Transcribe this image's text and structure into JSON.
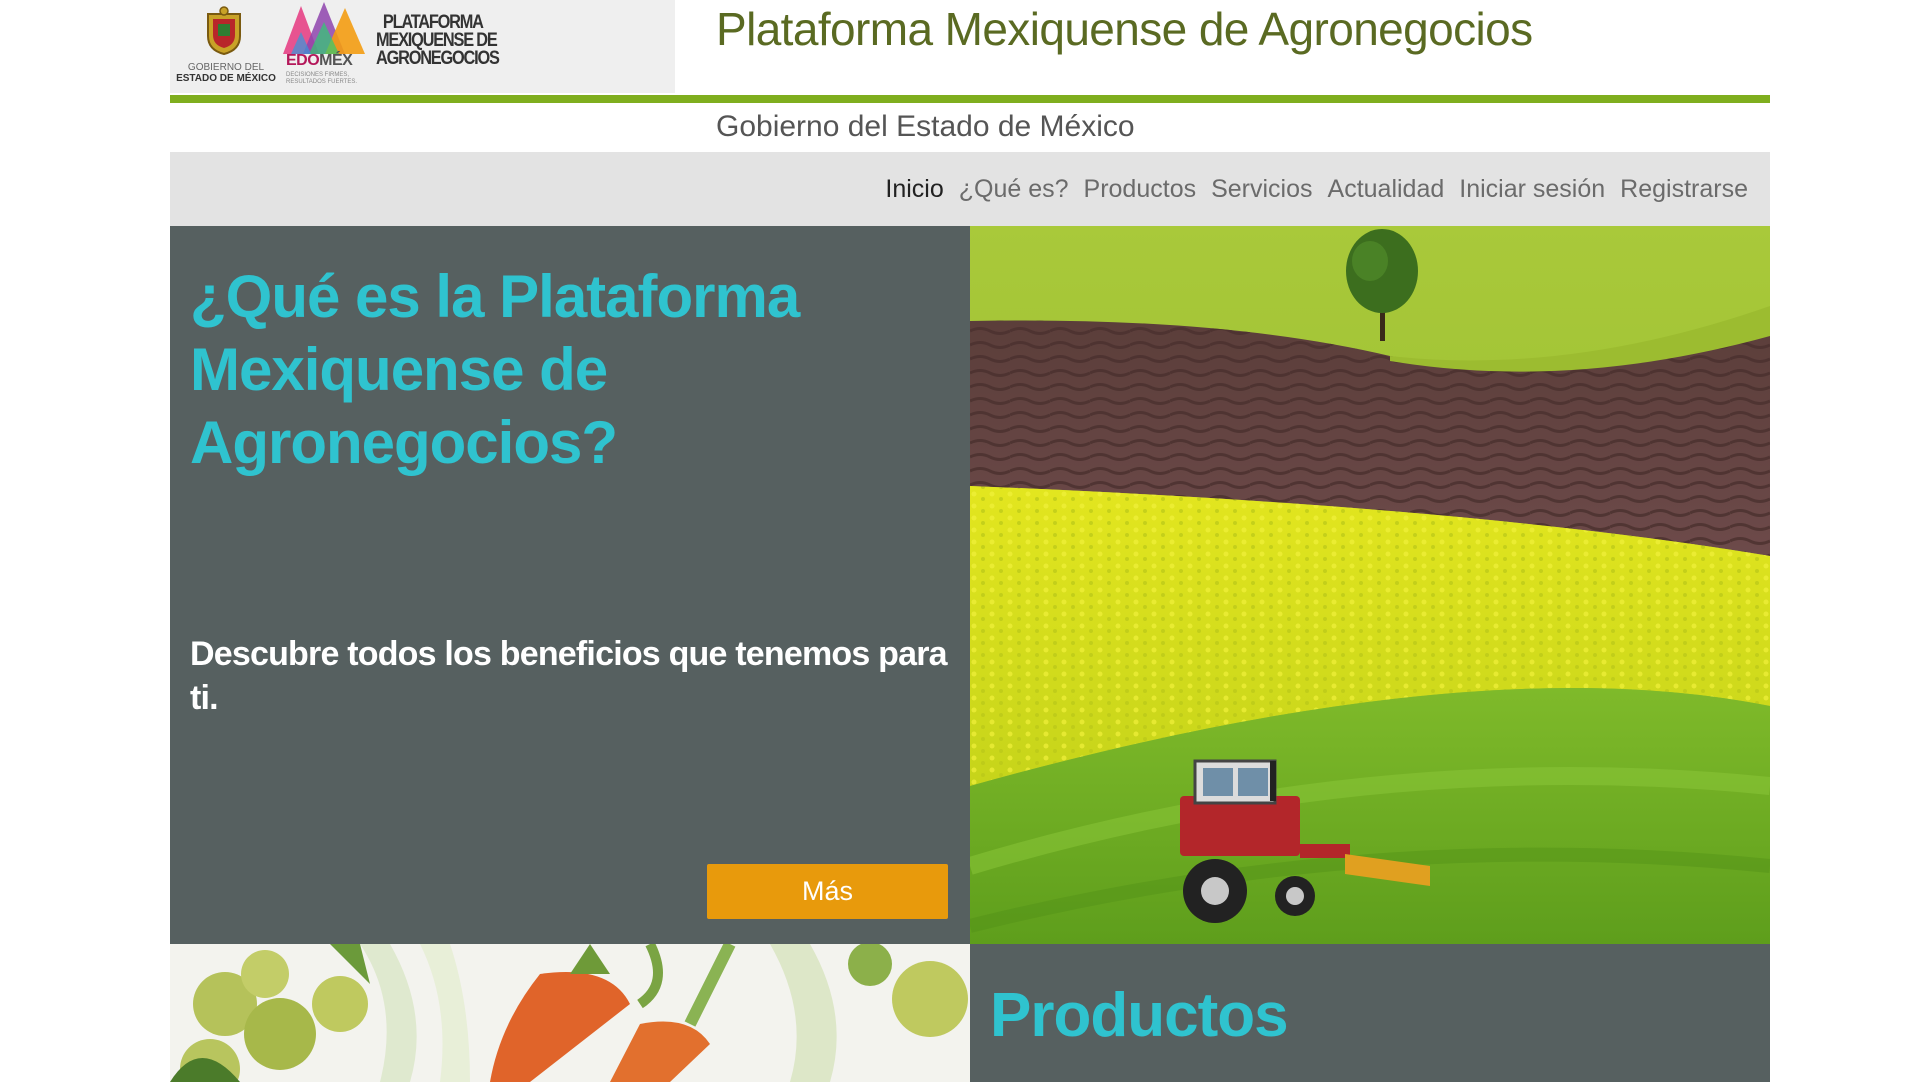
{
  "header": {
    "gob_logo_line1": "GOBIERNO DEL",
    "gob_logo_line2": "ESTADO DE MÉXICO",
    "edomex_prefix": "EDO",
    "edomex_suffix": "MÉX",
    "edomex_slogan_line1": "DECISIONES FIRMES,",
    "edomex_slogan_line2": "RESULTADOS FUERTES.",
    "platform_logo_line1": "PLATAFORMA",
    "platform_logo_line2": "MEXIQUENSE DE",
    "platform_logo_line3": "AGRONEGOCIOS",
    "site_title": "Plataforma Mexiquense de Agronegocios",
    "subtitle": "Gobierno del Estado de México"
  },
  "nav": {
    "items": [
      {
        "label": "Inicio"
      },
      {
        "label": "¿Qué es?"
      },
      {
        "label": "Productos"
      },
      {
        "label": "Servicios"
      },
      {
        "label": "Actualidad"
      },
      {
        "label": "Iniciar sesión"
      },
      {
        "label": "Registrarse"
      }
    ],
    "active": "Inicio"
  },
  "hero": {
    "heading": "¿Qué es la Plataforma Mexiquense de Agronegocios?",
    "description": "Descubre todos los beneficios que tenemos para ti.",
    "button_label": "Más"
  },
  "productos": {
    "heading": "Productos"
  },
  "colors": {
    "accent_green": "#7fae1e",
    "title_olive": "#5a6a22",
    "panel_gray": "#566060",
    "heading_cyan": "#2fc3cf",
    "button_orange": "#e89a0c",
    "nav_bg": "#e3e3e3"
  }
}
